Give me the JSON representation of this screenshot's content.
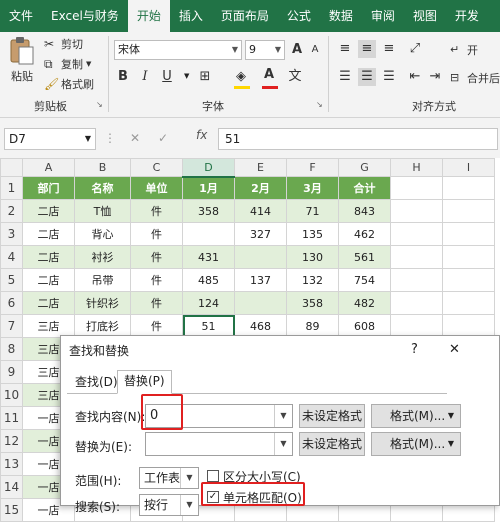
{
  "ribbon": {
    "tabs": [
      "文件",
      "Excel与财务",
      "开始",
      "插入",
      "页面布局",
      "公式",
      "数据",
      "审阅",
      "视图",
      "开发"
    ],
    "active_tab": "开始",
    "clipboard": {
      "paste": "粘贴",
      "cut": "剪切",
      "copy": "复制",
      "format_painter": "格式刷",
      "group": "剪贴板"
    },
    "font": {
      "name": "宋体",
      "size": "9",
      "bold": "B",
      "italic": "I",
      "underline": "U",
      "grow": "A",
      "shrink": "A",
      "group": "字体"
    },
    "align": {
      "group": "对齐方式",
      "wrap": "自动换行",
      "merge": "合并后居中",
      "wrap_short": "开",
      "merge_short": "合并"
    },
    "colors": {
      "accent": "#217346",
      "font_color": "#e02020",
      "fill_color": "#ffd700"
    }
  },
  "formula_bar": {
    "name_box": "D7",
    "fx": "fx",
    "value": "51"
  },
  "sheet": {
    "columns": [
      "A",
      "B",
      "C",
      "D",
      "E",
      "F",
      "G",
      "H",
      "I"
    ],
    "selected_column": "D",
    "rows": [
      [
        "部门",
        "名称",
        "单位",
        "1月",
        "2月",
        "3月",
        "合计",
        "",
        ""
      ],
      [
        "二店",
        "T恤",
        "件",
        "358",
        "414",
        "71",
        "843",
        "",
        ""
      ],
      [
        "二店",
        "背心",
        "件",
        "",
        "327",
        "135",
        "462",
        "",
        ""
      ],
      [
        "二店",
        "衬衫",
        "件",
        "431",
        "",
        "130",
        "561",
        "",
        ""
      ],
      [
        "二店",
        "吊带",
        "件",
        "485",
        "137",
        "132",
        "754",
        "",
        ""
      ],
      [
        "二店",
        "针织衫",
        "件",
        "124",
        "",
        "358",
        "482",
        "",
        ""
      ],
      [
        "三店",
        "打底衫",
        "件",
        "51",
        "468",
        "89",
        "608",
        "",
        ""
      ],
      [
        "三店",
        "",
        "",
        "",
        "",
        "",
        "",
        "",
        ""
      ],
      [
        "三店",
        "",
        "",
        "",
        "",
        "",
        "",
        "",
        ""
      ],
      [
        "三店",
        "",
        "",
        "",
        "",
        "",
        "",
        "",
        ""
      ],
      [
        "一店",
        "",
        "",
        "",
        "",
        "",
        "",
        "",
        ""
      ],
      [
        "一店",
        "",
        "",
        "",
        "",
        "",
        "",
        "",
        ""
      ],
      [
        "一店",
        "",
        "",
        "",
        "",
        "",
        "",
        "",
        ""
      ],
      [
        "一店",
        "",
        "",
        "",
        "",
        "",
        "",
        "",
        ""
      ],
      [
        "一店",
        "",
        "",
        "",
        "",
        "",
        "",
        "",
        ""
      ]
    ]
  },
  "dialog": {
    "title": "查找和替换",
    "help": "?",
    "close": "✕",
    "tab_find": "查找(D)",
    "tab_replace": "替换(P)",
    "find_label": "查找内容(N):",
    "find_value": "0",
    "replace_label": "替换为(E):",
    "replace_value": "",
    "no_format": "未设定格式",
    "format_button": "格式(M)...",
    "scope_label": "范围(H):",
    "scope_value": "工作表",
    "search_label": "搜索(S):",
    "search_value": "按行",
    "match_case": "区分大小写(C)",
    "match_cell": "单元格匹配(O)",
    "match_case_checked": false,
    "match_cell_checked": true
  }
}
